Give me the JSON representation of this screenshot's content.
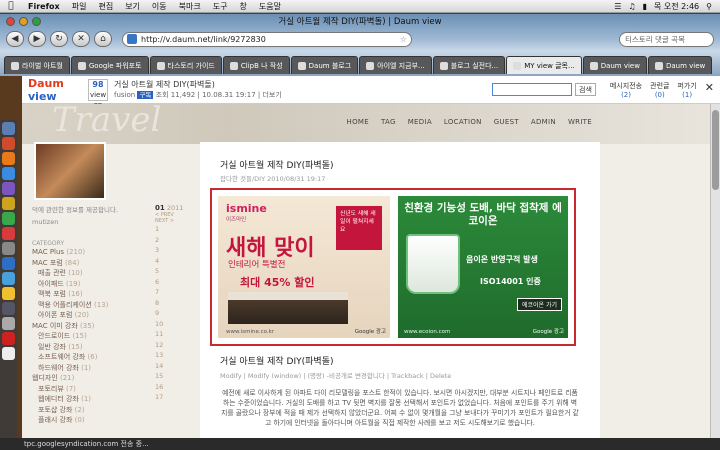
{
  "menubar": {
    "app": "Firefox",
    "items": [
      "파일",
      "편집",
      "보기",
      "이동",
      "북마크",
      "도구",
      "창",
      "도움말"
    ],
    "clock": "목 오전 2:46"
  },
  "browser": {
    "window_title": "거실 아트월 제작 DIY(파벽돌) | Daum view",
    "url": "http://v.daum.net/link/9272830",
    "search_text": "티스토리 댓글 곡목",
    "tabs": [
      {
        "label": "라이벌 아트월",
        "active": false
      },
      {
        "label": "Google 파워포토",
        "active": false
      },
      {
        "label": "타스토리 가이드",
        "active": false
      },
      {
        "label": "ClipB 나 작성",
        "active": false
      },
      {
        "label": "Daum 블로그",
        "active": false
      },
      {
        "label": "아이엘 지금부...",
        "active": false
      },
      {
        "label": "블로그 실전다...",
        "active": false
      },
      {
        "label": "MY view 글목...",
        "active": true
      },
      {
        "label": "Daum view",
        "active": false
      },
      {
        "label": "Daum view",
        "active": false
      }
    ]
  },
  "viewbar": {
    "logo_left": "Daum",
    "logo_right": "view",
    "count": "98",
    "count_label": "view on",
    "title": "거실 아트월 제작 DIY(파벽돌)",
    "author": "fusion",
    "badge": "구독",
    "views": "조회 11,492",
    "date": "10.08.31 19:17",
    "more": "더보기",
    "search_button": "검색",
    "messages_label": "메시지전송",
    "messages_count": "(2)",
    "related_label": "관련글",
    "related_count": "(0)",
    "close_label": "퍼가기",
    "close_count": "(1)"
  },
  "blog": {
    "header_word": "Travel",
    "nav": [
      "HOME",
      "TAG",
      "MEDIA",
      "LOCATION",
      "GUEST",
      "ADMIN",
      "WRITE"
    ],
    "profile_desc": "덕에 관련한 정보를 제공합니다.",
    "profile_name": "mutizen",
    "category_head": "CATEGORY",
    "categories": [
      {
        "name": "MAC Plus",
        "count": "(210)"
      },
      {
        "name": "MAC 포럼",
        "count": "(84)"
      },
      {
        "name": "매출 관련",
        "count": "(10)"
      },
      {
        "name": "아이패드",
        "count": "(19)"
      },
      {
        "name": "맥북 포럼",
        "count": "(16)"
      },
      {
        "name": "맥용 어플리케이션",
        "count": "(13)"
      },
      {
        "name": "아이폰 포럼",
        "count": "(20)"
      },
      {
        "name": "MAC 이미 강좌",
        "count": "(35)"
      },
      {
        "name": "안드로이드",
        "count": "(15)"
      },
      {
        "name": "일반 강좌",
        "count": "(15)"
      },
      {
        "name": "소프트웨어 강좌",
        "count": "(6)"
      },
      {
        "name": "하드웨어 강좌",
        "count": "(1)"
      },
      {
        "name": "웹디자인",
        "count": "(21)"
      },
      {
        "name": "포토리뷰",
        "count": "(7)"
      },
      {
        "name": "웹에디터 강좌",
        "count": "(1)"
      },
      {
        "name": "포토샵 강좌",
        "count": "(2)"
      },
      {
        "name": "플래시 강좌",
        "count": "(0)"
      }
    ],
    "calendar_month": "01",
    "calendar_year": "2011",
    "calendar_nav": "< PREV  NEXT >",
    "calendar_days": [
      "1",
      "2",
      "3",
      "4",
      "5",
      "6",
      "7",
      "8",
      "9",
      "10",
      "11",
      "12",
      "13",
      "14",
      "15",
      "16",
      "17"
    ],
    "post": {
      "title": "거실 아트월 제작 DIY(파벽돌)",
      "meta": "잡다한 것들/DIY  2010/08/31 19:17",
      "ad1": {
        "brand": "ismine",
        "brand_sub": "이즈마인",
        "headline": "새해 맞이",
        "sub": "인테리어 특별전",
        "pct": "최대 45% 할인",
        "red_box": "신년도 새해 새 일이 펼쳐지세요",
        "url": "www.ismine.co.kr",
        "google": "Google 광고"
      },
      "ad2": {
        "headline": "친환경 기능성 도배, 바닥 접착제 에코이온",
        "t2": "음이온 반영구적 발생",
        "t3": "ISO14001 인증",
        "button": "에코이온 가기",
        "url": "www.ecoion.com",
        "google": "Google 광고"
      },
      "title2": "거실 아트월 제작 DIY(파벽돌)",
      "actions": "Modify | Modify (window) | (명랑) -비공개로 변경합니다 | Trackback | Delete",
      "body": "예전에 새로 이사하게 된 아파트 다이 리모델링을 포스트 한적이 있습니다. 보시면 아시겠지만, 대부분 시트지나 페인트로 리폼하는 수준이었습니다. 거실의 도배를 하고 TV 뒷면 벽지를 잘몽 선택해서 포인트가 없었습니다. 처음에 포인트를 주기 위해 벽지를 골랐으나 장부에 적을 때 제가 선택하지 않았더군요. 어찌 수 없이 몇개월을 그냥 보내다가 꾸미기가 포인트가 필요한거 같고 하기에 인터넷을 돌아다니며 아트월을 직접 제작한 사례를 보고 저도 시도해보기로 했습니다."
    }
  },
  "statusbar": "tpc.googlesyndication.com 전송 중..."
}
